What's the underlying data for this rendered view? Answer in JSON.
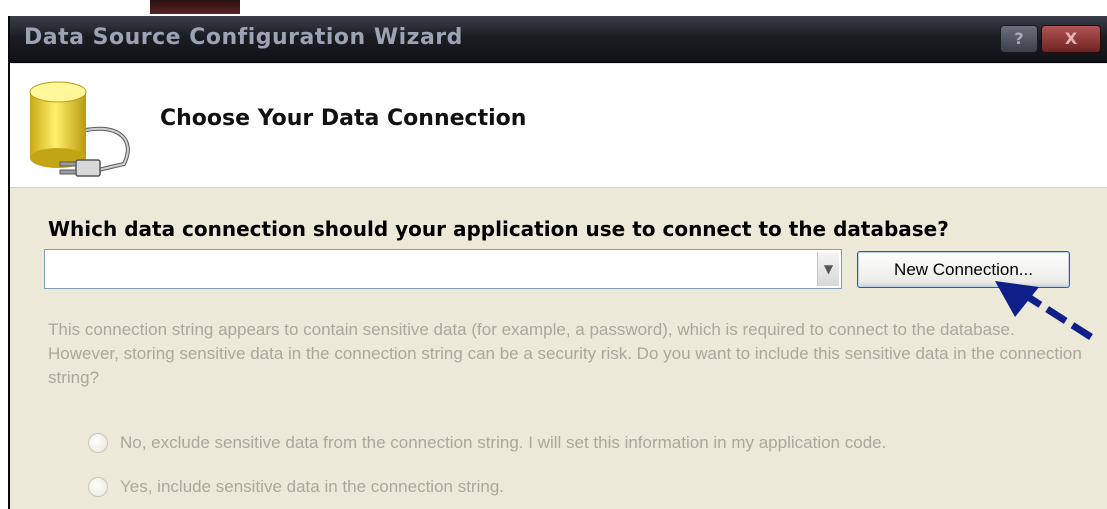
{
  "window": {
    "title": "Data Source Configuration Wizard",
    "help_label": "?",
    "close_label": "X"
  },
  "header": {
    "heading": "Choose Your Data Connection",
    "icon": "database-plug-icon"
  },
  "connection": {
    "question": "Which data connection should your application use to connect to the database?",
    "selected_value": "",
    "dropdown_icon": "chevron-down-icon",
    "new_connection_label": "New Connection..."
  },
  "sensitive": {
    "warning_text": "This connection string appears to contain sensitive data (for example, a password), which is required to connect to the database. However, storing sensitive data in the connection string can be a security risk. Do you want to include this sensitive data in the connection string?",
    "options": [
      {
        "label": "No, exclude sensitive data from the connection string. I will set this information in my application code.",
        "selected": false,
        "enabled": false
      },
      {
        "label": "Yes, include sensitive data in the connection string.",
        "selected": false,
        "enabled": false
      }
    ]
  },
  "annotation": {
    "icon": "arrow-pointer-icon",
    "color": "#0f1f8a"
  },
  "colors": {
    "titlebar": "#1b1d23",
    "title_text": "#9ba3b4",
    "dialog_bg": "#ece9d8",
    "disabled_text": "#a8a89c",
    "button_border": "#1f5fb8"
  }
}
